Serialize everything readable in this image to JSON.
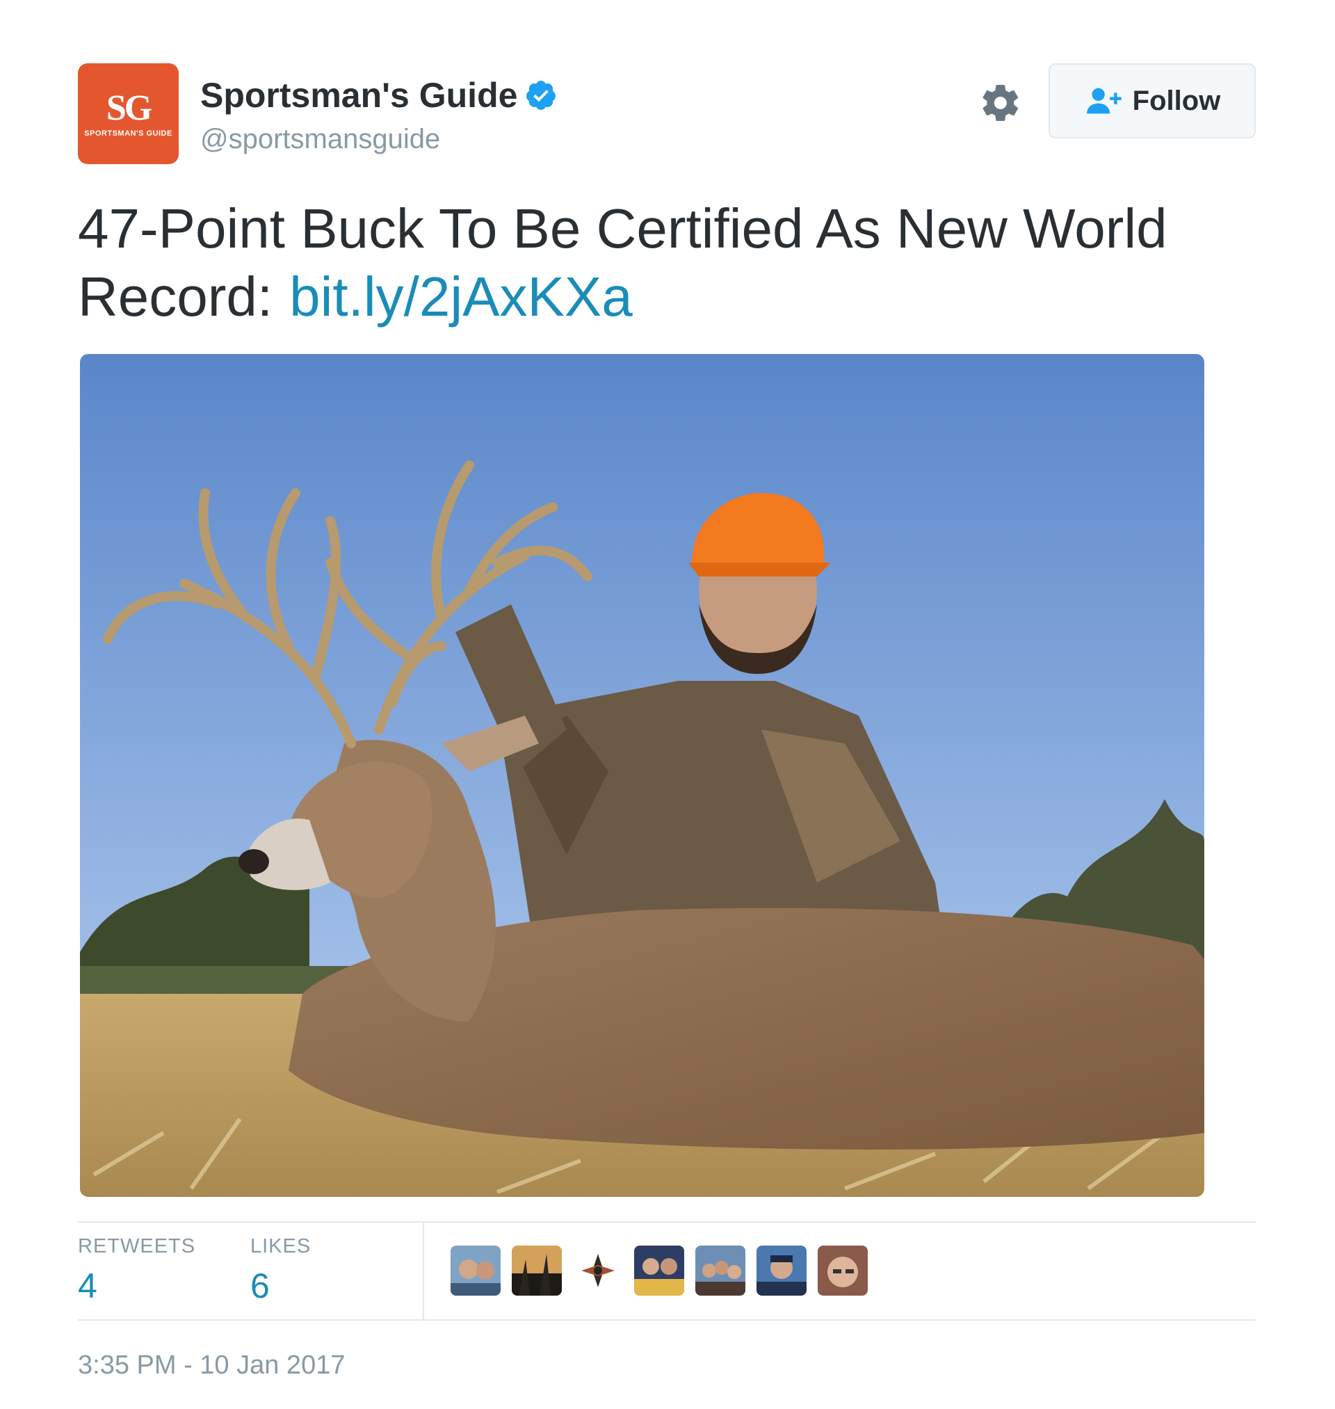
{
  "account": {
    "avatar_monogram": "SG",
    "avatar_caption": "SPORTSMAN'S GUIDE",
    "display_name": "Sportsman's Guide",
    "handle": "@sportsmansguide",
    "verified_icon": "verified-badge-icon",
    "brand_color": "#e4572e"
  },
  "header": {
    "settings_icon": "gear-icon",
    "follow_icon": "follow-user-icon",
    "follow_label": "Follow"
  },
  "tweet": {
    "text": "47-Point Buck To Be Certified As New World Record:",
    "link": "bit.ly/2jAxKXa",
    "link_color": "#1a8cb8"
  },
  "stats": {
    "retweets_label": "RETWEETS",
    "retweets_count": "4",
    "likes_label": "LIKES",
    "likes_count": "6",
    "liker_avatars": 7
  },
  "timestamp": "3:35 PM - 10 Jan 2017"
}
